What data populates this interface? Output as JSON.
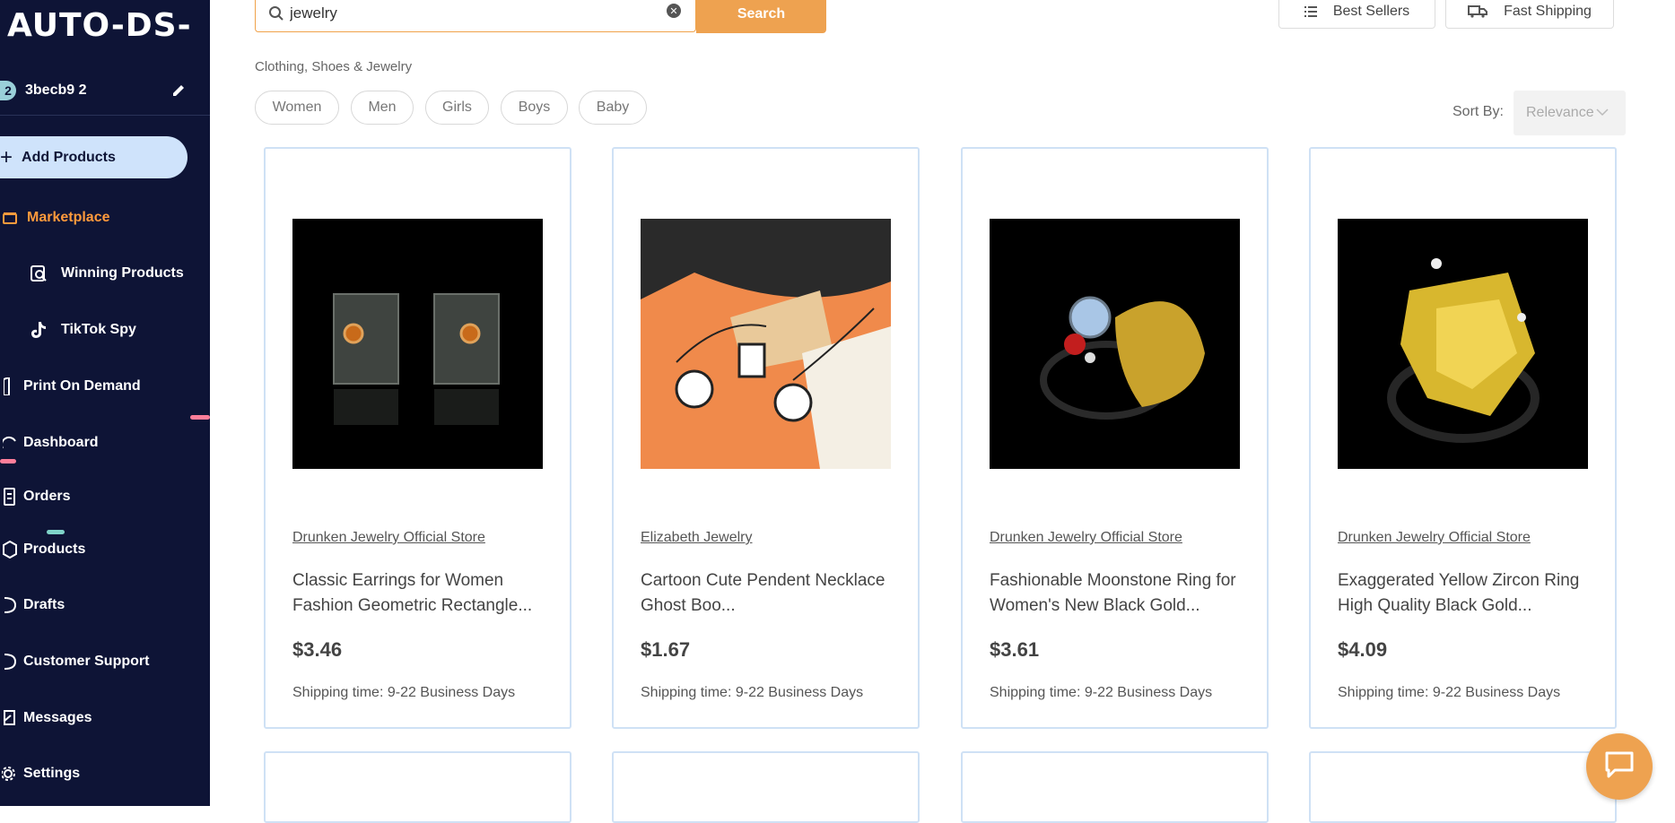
{
  "sidebar": {
    "logo": "AUTO-DS-",
    "account_number": "2",
    "account_name": "3becb9 2",
    "add_products_label": "Add Products",
    "items": [
      {
        "label": "Marketplace"
      },
      {
        "label": "Winning Products"
      },
      {
        "label": "TikTok Spy"
      },
      {
        "label": "Print On Demand"
      },
      {
        "label": "Dashboard"
      },
      {
        "label": "Orders"
      },
      {
        "label": "Products"
      },
      {
        "label": "Drafts"
      },
      {
        "label": "Customer Support"
      },
      {
        "label": "Messages"
      },
      {
        "label": "Settings"
      }
    ],
    "colors": {
      "background": "#0e1436",
      "active": "#ff9a3c",
      "add_button": "#cfe3fb"
    }
  },
  "search": {
    "value": "jewelry",
    "button_label": "Search"
  },
  "top_buttons": {
    "best_sellers": "Best Sellers",
    "fast_shipping": "Fast Shipping"
  },
  "category": "Clothing, Shoes & Jewelry",
  "chips": [
    "Women",
    "Men",
    "Girls",
    "Boys",
    "Baby"
  ],
  "sort": {
    "label": "Sort By:",
    "value": "Relevance"
  },
  "products": [
    {
      "store": "Drunken Jewelry Official Store",
      "title": "Classic Earrings for Women Fashion Geometric Rectangle...",
      "price": "$3.46",
      "shipping": "Shipping time: 9-22 Business Days"
    },
    {
      "store": "Elizabeth Jewelry",
      "title": "Cartoon Cute Pendent Necklace Ghost Boo...",
      "price": "$1.67",
      "shipping": "Shipping time: 9-22 Business Days"
    },
    {
      "store": "Drunken Jewelry Official Store",
      "title": "Fashionable Moonstone Ring for Women's New Black Gold...",
      "price": "$3.61",
      "shipping": "Shipping time: 9-22 Business Days"
    },
    {
      "store": "Drunken Jewelry Official Store",
      "title": "Exaggerated Yellow Zircon Ring High Quality Black Gold...",
      "price": "$4.09",
      "shipping": "Shipping time: 9-22 Business Days"
    }
  ],
  "accent_color": "#eea250"
}
